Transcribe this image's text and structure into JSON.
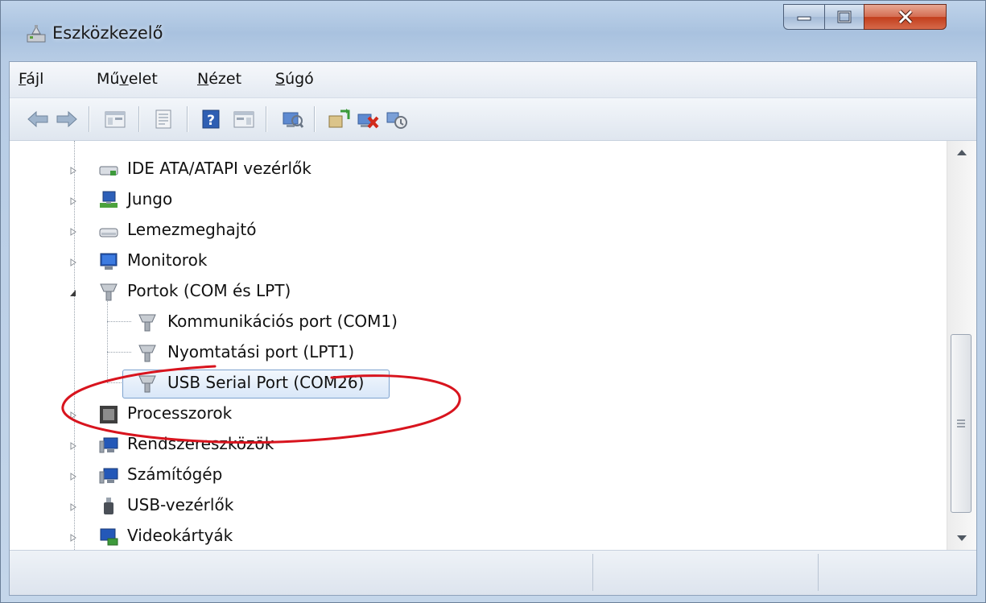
{
  "window": {
    "title": "Eszközkezelő"
  },
  "menu": [
    {
      "pre": "",
      "acc": "F",
      "post": "ájl"
    },
    {
      "pre": "Mű",
      "acc": "v",
      "post": "elet"
    },
    {
      "pre": "",
      "acc": "N",
      "post": "ézet"
    },
    {
      "pre": "",
      "acc": "S",
      "post": "úgó"
    }
  ],
  "toolbar": {
    "icons": [
      "back-arrow-icon",
      "forward-arrow-icon",
      "console-tree-icon",
      "properties-icon",
      "help-icon",
      "action-pane-icon",
      "scan-hardware-icon",
      "update-driver-icon",
      "disable-device-icon",
      "uninstall-device-icon"
    ]
  },
  "tree": {
    "items": [
      {
        "label": "IDE ATA/ATAPI vezérlők",
        "icon": "ide-controller-icon",
        "expanded": false,
        "level": 0
      },
      {
        "label": "Jungo",
        "icon": "jungo-device-icon",
        "expanded": false,
        "level": 0
      },
      {
        "label": "Lemezmeghajtó",
        "icon": "disk-drive-icon",
        "expanded": false,
        "level": 0
      },
      {
        "label": "Monitorok",
        "icon": "monitor-icon",
        "expanded": false,
        "level": 0
      },
      {
        "label": "Portok (COM és LPT)",
        "icon": "port-icon",
        "expanded": true,
        "level": 0
      },
      {
        "label": "Kommunikációs port (COM1)",
        "icon": "port-icon",
        "level": 1
      },
      {
        "label": "Nyomtatási port (LPT1)",
        "icon": "port-icon",
        "level": 1
      },
      {
        "label": "USB Serial Port (COM26)",
        "icon": "port-icon",
        "level": 1,
        "selected": true
      },
      {
        "label": "Processzorok",
        "icon": "processor-icon",
        "expanded": false,
        "level": 0
      },
      {
        "label": "Rendszereszközök",
        "icon": "system-device-icon",
        "expanded": false,
        "level": 0
      },
      {
        "label": "Számítógép",
        "icon": "computer-icon",
        "expanded": false,
        "level": 0
      },
      {
        "label": "USB-vezérlők",
        "icon": "usb-controller-icon",
        "expanded": false,
        "level": 0
      },
      {
        "label": "Videokártyák",
        "icon": "display-adapter-icon",
        "expanded": false,
        "level": 0
      }
    ]
  },
  "annotation": {
    "color": "#d8141e"
  }
}
